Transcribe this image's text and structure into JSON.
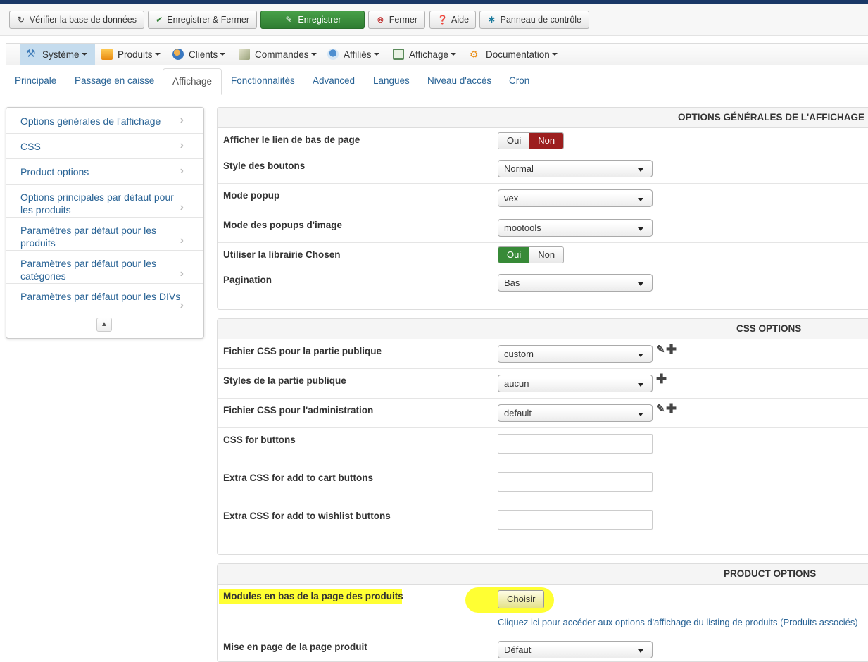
{
  "toolbar": {
    "check_db": "Vérifier la base de données",
    "save_close": "Enregistrer & Fermer",
    "save": "Enregistrer",
    "close": "Fermer",
    "help": "Aide",
    "control_panel": "Panneau de contrôle"
  },
  "menu": {
    "system": "Système",
    "products": "Produits",
    "customers": "Clients",
    "orders": "Commandes",
    "affiliates": "Affiliés",
    "display": "Affichage",
    "documentation": "Documentation"
  },
  "tabs": [
    "Principale",
    "Passage en caisse",
    "Affichage",
    "Fonctionnalités",
    "Advanced",
    "Langues",
    "Niveau d'accès",
    "Cron"
  ],
  "sidenav": [
    "Options générales de l'affichage",
    "CSS",
    "Product options",
    "Options principales par défaut pour les produits",
    "Paramètres par défaut pour les produits",
    "Paramètres par défaut pour les catégories",
    "Paramètres par défaut pour les DIVs"
  ],
  "general": {
    "title": "OPTIONS GÉNÉRALES DE L'AFFICHAGE",
    "footer_link_label": "Afficher le lien de bas de page",
    "yes": "Oui",
    "no": "Non",
    "button_style_label": "Style des boutons",
    "button_style_value": "Normal",
    "popup_label": "Mode popup",
    "popup_value": "vex",
    "image_popup_label": "Mode des popups d'image",
    "image_popup_value": "mootools",
    "chosen_label": "Utiliser la librairie Chosen",
    "pagination_label": "Pagination",
    "pagination_value": "Bas"
  },
  "css": {
    "title": "CSS OPTIONS",
    "frontend_css_label": "Fichier CSS pour la partie publique",
    "frontend_css_value": "custom",
    "frontend_styles_label": "Styles de la partie publique",
    "frontend_styles_value": "aucun",
    "admin_css_label": "Fichier CSS pour l'administration",
    "admin_css_value": "default",
    "buttons_css_label": "CSS for buttons",
    "cart_css_label": "Extra CSS for add to cart buttons",
    "wishlist_css_label": "Extra CSS for add to wishlist buttons"
  },
  "product": {
    "title": "PRODUCT OPTIONS",
    "modules_label": "Modules en bas de la page des produits",
    "choose": "Choisir",
    "link_text": "Cliquez ici pour accéder aux options d'affichage du listing de produits (Produits associés)",
    "layout_label": "Mise en page de la page produit",
    "layout_value": "Défaut"
  },
  "colors": {
    "top_bar": "#1a3867",
    "save_green": "#378a37",
    "no_red": "#9c1e1e",
    "link_blue": "#2a6496",
    "highlight": "#ffff33"
  }
}
